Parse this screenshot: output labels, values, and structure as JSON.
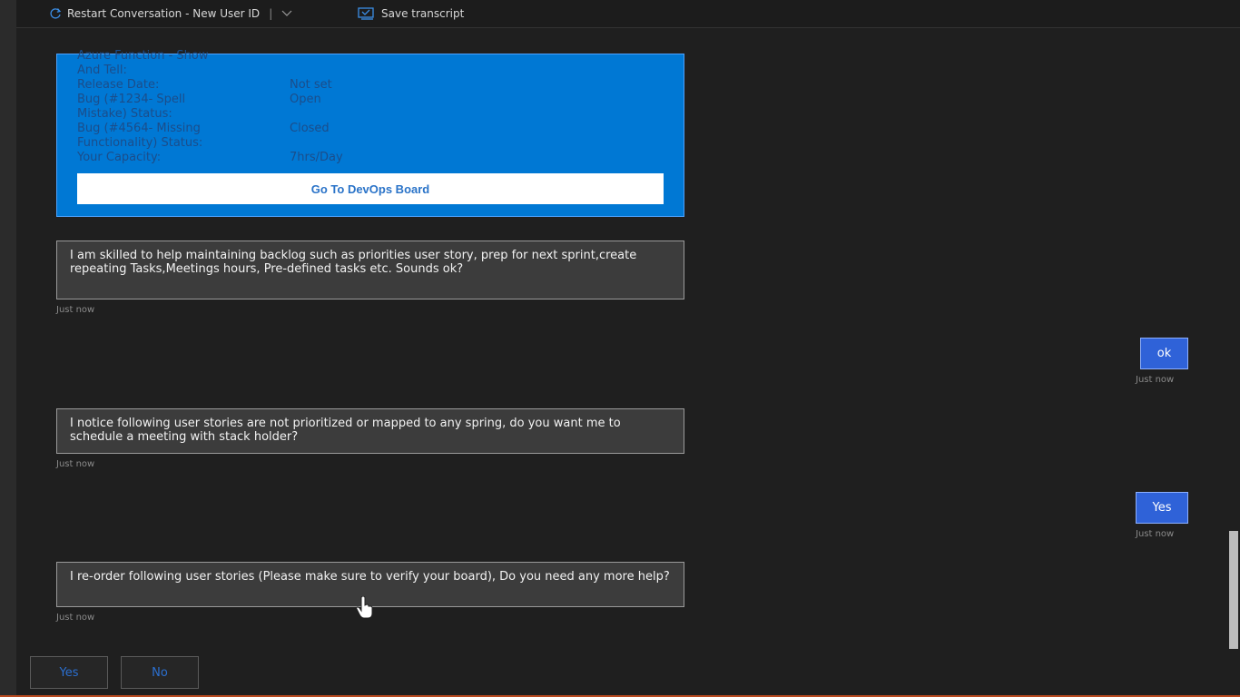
{
  "toolbar": {
    "restart_label": "Restart Conversation - New User ID",
    "separator": "|",
    "save_label": "Save transcript"
  },
  "card": {
    "facts": [
      {
        "key": "Azure Function - Show",
        "value": ""
      },
      {
        "key": "And Tell:",
        "value": ""
      },
      {
        "key": "Release Date:",
        "value": "Not set"
      },
      {
        "key": "Bug (#1234- Spell",
        "value": "Open"
      },
      {
        "key": "Mistake) Status:",
        "value": ""
      },
      {
        "key": "Bug (#4564- Missing",
        "value": "Closed"
      },
      {
        "key": "Functionality) Status:",
        "value": ""
      },
      {
        "key": "Your Capacity:",
        "value": "7hrs/Day"
      }
    ],
    "button_label": "Go To DevOps Board"
  },
  "messages": [
    {
      "text": "I am skilled to help maintaining backlog such as priorities user story, prep for next sprint,create repeating Tasks,Meetings hours, Pre-defined tasks etc. Sounds ok?",
      "timestamp": "Just now"
    },
    {
      "text": "I notice following user stories are not prioritized or mapped to any spring, do you want me to schedule a meeting with stack holder?",
      "timestamp": "Just now"
    },
    {
      "text": "I re-order following user stories (Please make sure to verify your board), Do you need any more help?",
      "timestamp": "Just now"
    }
  ],
  "user_messages": [
    {
      "text": "ok",
      "timestamp": "Just now"
    },
    {
      "text": "Yes",
      "timestamp": "Just now"
    }
  ],
  "suggested_actions": [
    {
      "label": "Yes"
    },
    {
      "label": "No"
    }
  ],
  "colors": {
    "background": "#1f1f1f",
    "card": "#0078d4",
    "user_bubble": "#2f62d8",
    "bot_bubble": "#3c3c3c"
  }
}
